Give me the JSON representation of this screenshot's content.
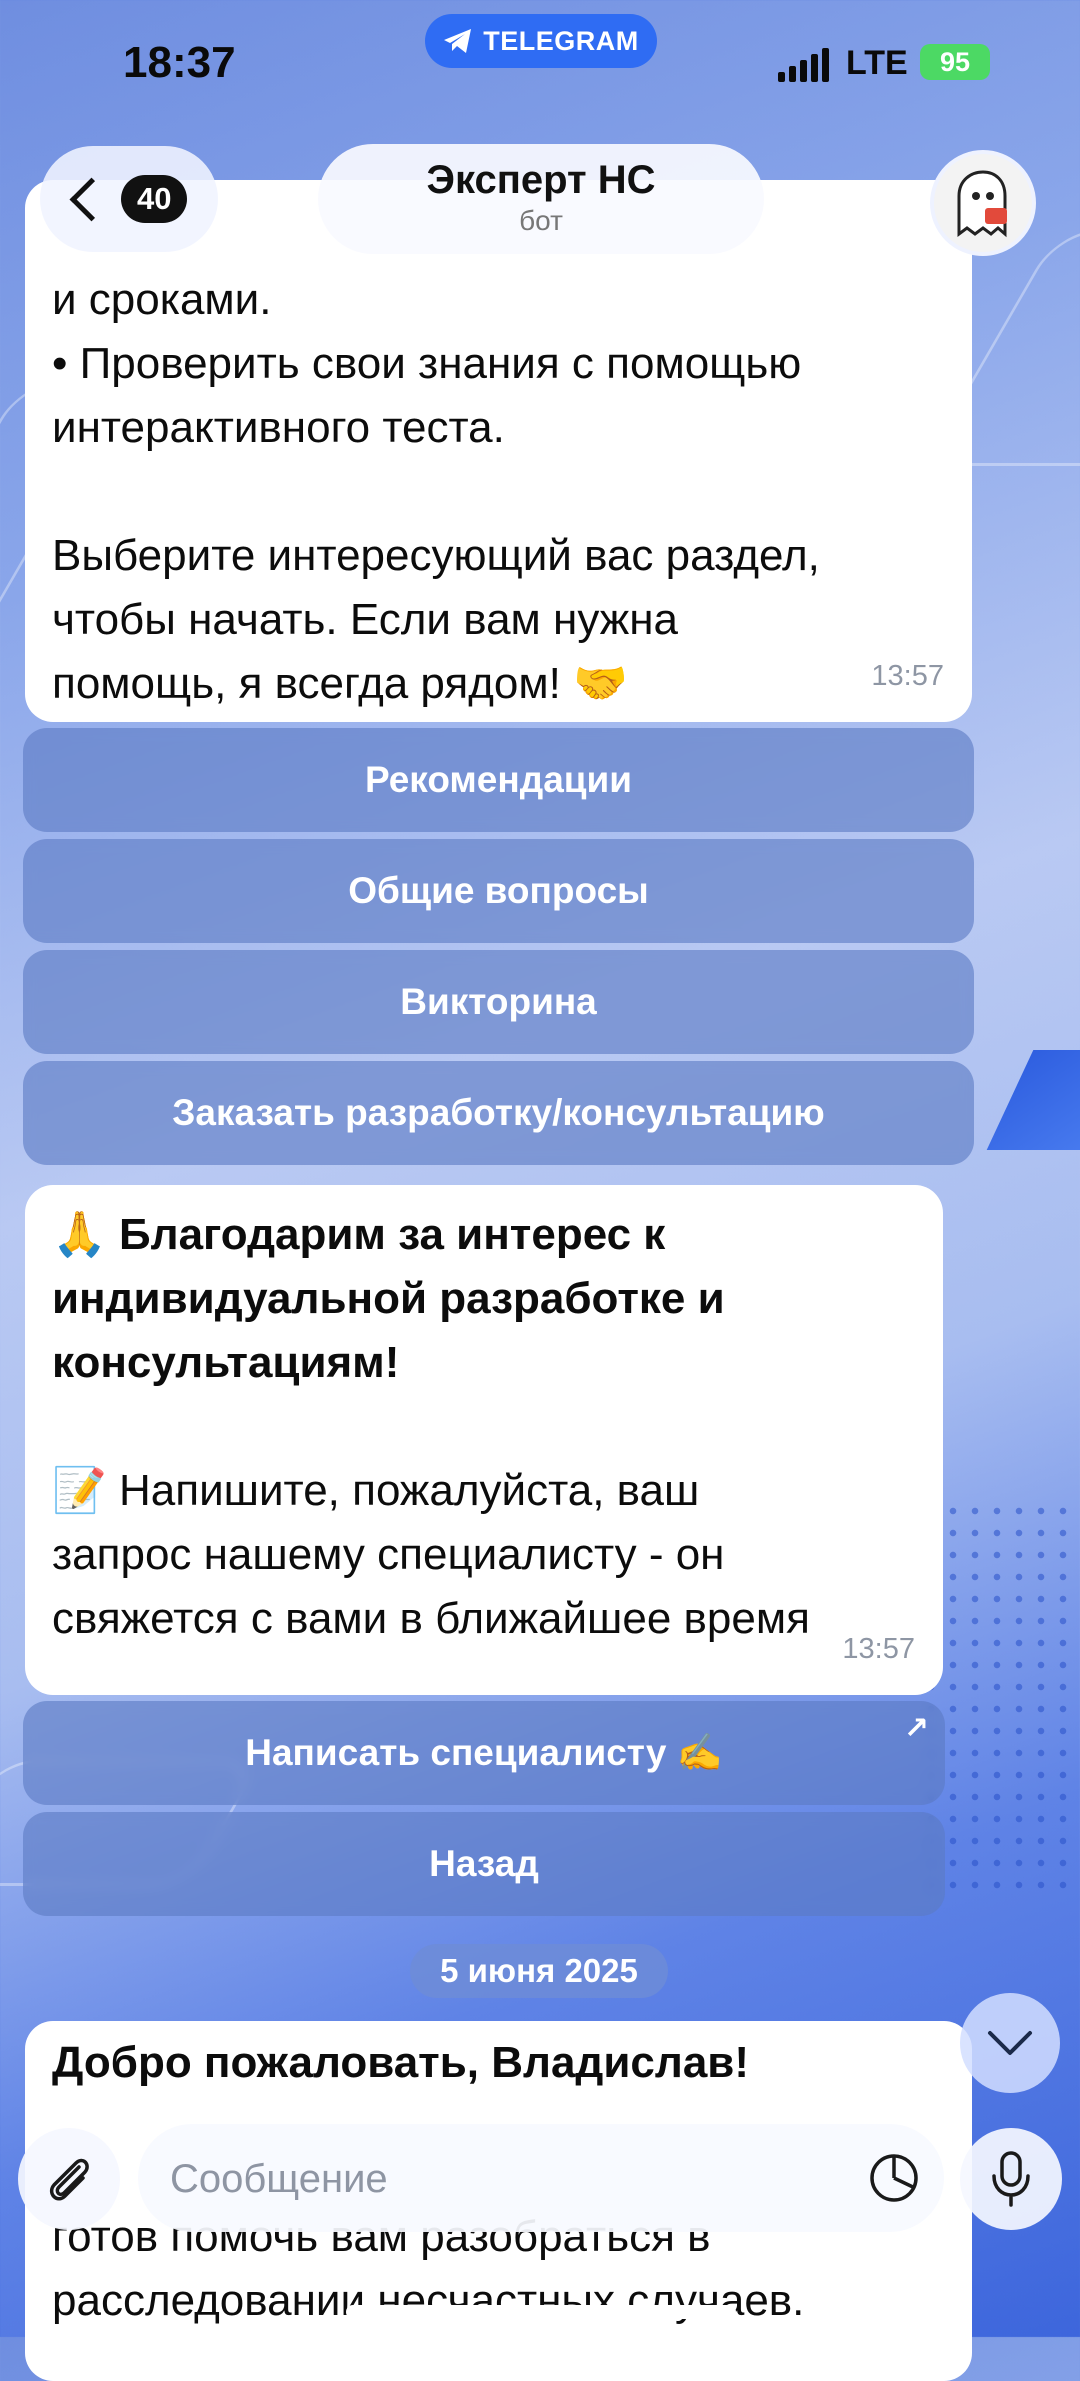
{
  "status": {
    "time": "18:37",
    "app_pill": "TELEGRAM",
    "network": "LTE",
    "battery": "95"
  },
  "header": {
    "back_count": "40",
    "title": "Эксперт НС",
    "subtitle": "бот"
  },
  "message1": {
    "lines": [
      "и сроками.",
      "• Проверить свои знания с помощью",
      "интерактивного теста.",
      "",
      "Выберите интересующий вас раздел,",
      "чтобы начать. Если вам нужна",
      "помощь, я всегда рядом! 🤝"
    ],
    "time": "13:57"
  },
  "keyboard1": [
    "Рекомендации",
    "Общие вопросы",
    "Викторина",
    "Заказать разработку/консультацию"
  ],
  "message2": {
    "bold_lines": [
      "🙏 Благодарим за интерес к",
      "индивидуальной разработке и",
      "консультациям!"
    ],
    "lines": [
      "📝 Напишите, пожалуйста, ваш",
      "запрос нашему специалисту - он",
      "свяжется с вами в ближайшее время"
    ],
    "time": "13:57"
  },
  "keyboard2": {
    "write_specialist": "Написать специалисту ✍️",
    "back": "Назад"
  },
  "date_separator": "5 июня 2025",
  "message3": {
    "title": "Добро пожаловать, Владислав!",
    "lines": [
      "готов помочь вам разобраться в",
      "расследовании несчастных случаев."
    ]
  },
  "composer": {
    "placeholder": "Сообщение"
  },
  "colors": {
    "accent": "#2f6cf3",
    "bubble": "#ffffff",
    "keyboard_button": "#5c7ac4"
  }
}
